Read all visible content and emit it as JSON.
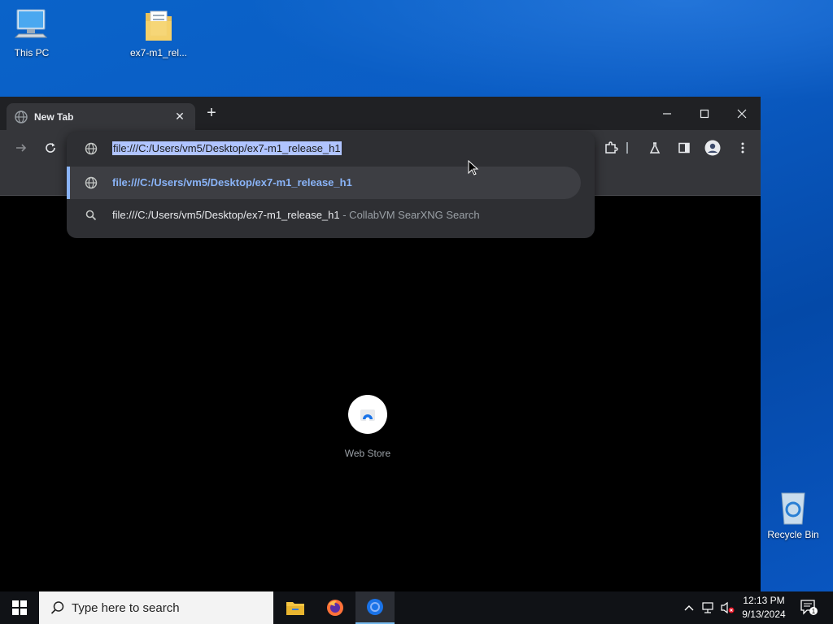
{
  "desktop": {
    "icons": [
      {
        "label": "This PC"
      },
      {
        "label": "ex7-m1_rel..."
      },
      {
        "label": "Recycle Bin"
      }
    ]
  },
  "browser": {
    "tab": {
      "title": "New Tab",
      "close": "✕"
    },
    "new_tab": "+",
    "window_controls": {
      "minimize": "—",
      "maximize": "☐",
      "close": "✕"
    },
    "omnibox": {
      "value": "file:///C:/Users/vm5/Desktop/ex7-m1_release_h1",
      "suggestions": [
        {
          "text": "file:///C:/Users/vm5/Desktop/ex7-m1_release_h1",
          "icon": "globe-icon"
        },
        {
          "text": "file:///C:/Users/vm5/Desktop/ex7-m1_release_h1",
          "source": " - CollabVM SearXNG Search",
          "icon": "search-icon"
        }
      ]
    },
    "shortcuts": [
      {
        "label": "Web Store"
      }
    ]
  },
  "taskbar": {
    "search_placeholder": "Type here to search",
    "clock": {
      "time": "12:13 PM",
      "date": "9/13/2024"
    },
    "notification_count": "1"
  },
  "colors": {
    "accent": "#8ab4f8",
    "selection": "#b0c4ff",
    "toolbar": "#35363a",
    "tabstrip": "#202124"
  }
}
